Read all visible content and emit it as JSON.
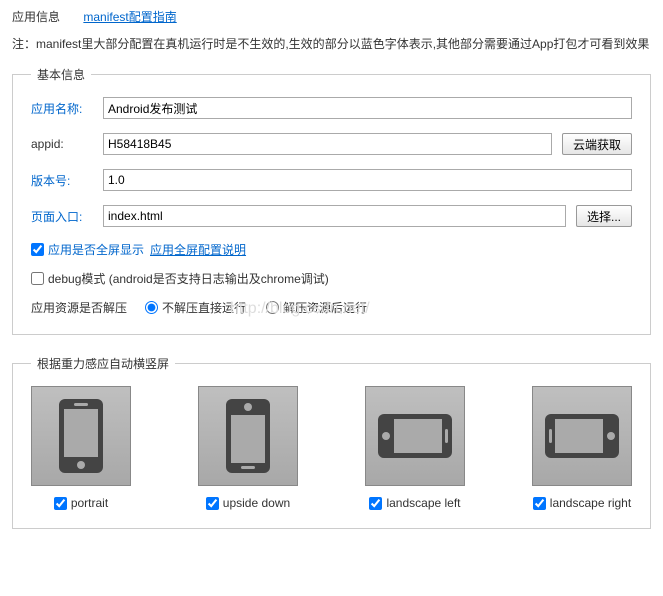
{
  "header": {
    "appinfo_label": "应用信息",
    "manifest_guide_link": "manifest配置指南"
  },
  "note": "注：manifest里大部分配置在真机运行时是不生效的,生效的部分以蓝色字体表示,其他部分需要通过App打包才可看到效果",
  "basic": {
    "legend": "基本信息",
    "appname_label": "应用名称:",
    "appname_value": "Android发布测试",
    "appid_label": "appid:",
    "appid_value": "H58418B45",
    "cloud_btn": "云端获取",
    "version_label": "版本号:",
    "version_value": "1.0",
    "entry_label": "页面入口:",
    "entry_value": "index.html",
    "choose_btn": "选择...",
    "fullscreen_label": "应用是否全屏显示",
    "fullscreen_link": "应用全屏配置说明",
    "debug_label": "debug模式 (android是否支持日志输出及chrome调试)",
    "decompress_label": "应用资源是否解压",
    "decompress_opt1": "不解压直接运行",
    "decompress_opt2": "解压资源后运行"
  },
  "orientation": {
    "legend": "根据重力感应自动横竖屏",
    "items": [
      {
        "label": "portrait"
      },
      {
        "label": "upside down"
      },
      {
        "label": "landscape left"
      },
      {
        "label": "landscape right"
      }
    ]
  },
  "watermark": "http://blog.csdn.net/"
}
